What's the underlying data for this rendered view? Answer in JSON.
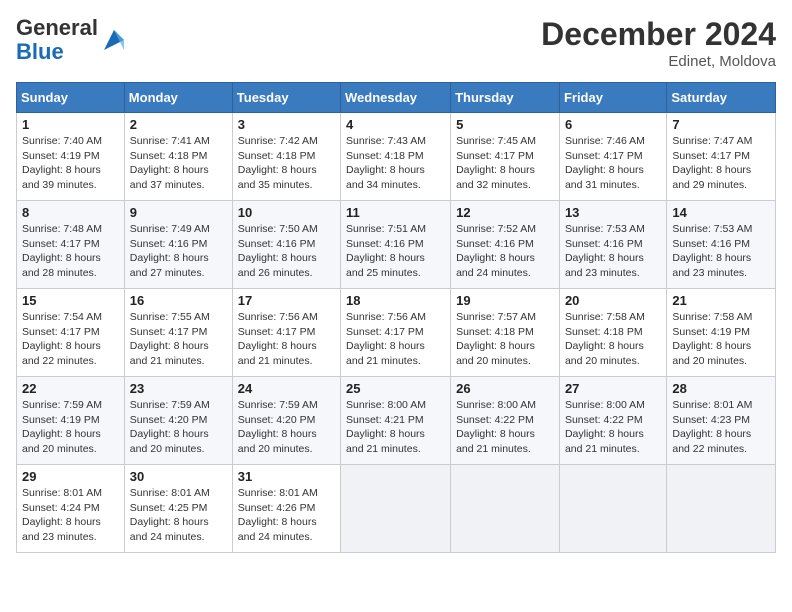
{
  "header": {
    "logo_line1": "General",
    "logo_line2": "Blue",
    "month": "December 2024",
    "location": "Edinet, Moldova"
  },
  "weekdays": [
    "Sunday",
    "Monday",
    "Tuesday",
    "Wednesday",
    "Thursday",
    "Friday",
    "Saturday"
  ],
  "weeks": [
    [
      {
        "day": "1",
        "sunrise": "7:40 AM",
        "sunset": "4:19 PM",
        "daylight": "8 hours and 39 minutes."
      },
      {
        "day": "2",
        "sunrise": "7:41 AM",
        "sunset": "4:18 PM",
        "daylight": "8 hours and 37 minutes."
      },
      {
        "day": "3",
        "sunrise": "7:42 AM",
        "sunset": "4:18 PM",
        "daylight": "8 hours and 35 minutes."
      },
      {
        "day": "4",
        "sunrise": "7:43 AM",
        "sunset": "4:18 PM",
        "daylight": "8 hours and 34 minutes."
      },
      {
        "day": "5",
        "sunrise": "7:45 AM",
        "sunset": "4:17 PM",
        "daylight": "8 hours and 32 minutes."
      },
      {
        "day": "6",
        "sunrise": "7:46 AM",
        "sunset": "4:17 PM",
        "daylight": "8 hours and 31 minutes."
      },
      {
        "day": "7",
        "sunrise": "7:47 AM",
        "sunset": "4:17 PM",
        "daylight": "8 hours and 29 minutes."
      }
    ],
    [
      {
        "day": "8",
        "sunrise": "7:48 AM",
        "sunset": "4:17 PM",
        "daylight": "8 hours and 28 minutes."
      },
      {
        "day": "9",
        "sunrise": "7:49 AM",
        "sunset": "4:16 PM",
        "daylight": "8 hours and 27 minutes."
      },
      {
        "day": "10",
        "sunrise": "7:50 AM",
        "sunset": "4:16 PM",
        "daylight": "8 hours and 26 minutes."
      },
      {
        "day": "11",
        "sunrise": "7:51 AM",
        "sunset": "4:16 PM",
        "daylight": "8 hours and 25 minutes."
      },
      {
        "day": "12",
        "sunrise": "7:52 AM",
        "sunset": "4:16 PM",
        "daylight": "8 hours and 24 minutes."
      },
      {
        "day": "13",
        "sunrise": "7:53 AM",
        "sunset": "4:16 PM",
        "daylight": "8 hours and 23 minutes."
      },
      {
        "day": "14",
        "sunrise": "7:53 AM",
        "sunset": "4:16 PM",
        "daylight": "8 hours and 23 minutes."
      }
    ],
    [
      {
        "day": "15",
        "sunrise": "7:54 AM",
        "sunset": "4:17 PM",
        "daylight": "8 hours and 22 minutes."
      },
      {
        "day": "16",
        "sunrise": "7:55 AM",
        "sunset": "4:17 PM",
        "daylight": "8 hours and 21 minutes."
      },
      {
        "day": "17",
        "sunrise": "7:56 AM",
        "sunset": "4:17 PM",
        "daylight": "8 hours and 21 minutes."
      },
      {
        "day": "18",
        "sunrise": "7:56 AM",
        "sunset": "4:17 PM",
        "daylight": "8 hours and 21 minutes."
      },
      {
        "day": "19",
        "sunrise": "7:57 AM",
        "sunset": "4:18 PM",
        "daylight": "8 hours and 20 minutes."
      },
      {
        "day": "20",
        "sunrise": "7:58 AM",
        "sunset": "4:18 PM",
        "daylight": "8 hours and 20 minutes."
      },
      {
        "day": "21",
        "sunrise": "7:58 AM",
        "sunset": "4:19 PM",
        "daylight": "8 hours and 20 minutes."
      }
    ],
    [
      {
        "day": "22",
        "sunrise": "7:59 AM",
        "sunset": "4:19 PM",
        "daylight": "8 hours and 20 minutes."
      },
      {
        "day": "23",
        "sunrise": "7:59 AM",
        "sunset": "4:20 PM",
        "daylight": "8 hours and 20 minutes."
      },
      {
        "day": "24",
        "sunrise": "7:59 AM",
        "sunset": "4:20 PM",
        "daylight": "8 hours and 20 minutes."
      },
      {
        "day": "25",
        "sunrise": "8:00 AM",
        "sunset": "4:21 PM",
        "daylight": "8 hours and 21 minutes."
      },
      {
        "day": "26",
        "sunrise": "8:00 AM",
        "sunset": "4:22 PM",
        "daylight": "8 hours and 21 minutes."
      },
      {
        "day": "27",
        "sunrise": "8:00 AM",
        "sunset": "4:22 PM",
        "daylight": "8 hours and 21 minutes."
      },
      {
        "day": "28",
        "sunrise": "8:01 AM",
        "sunset": "4:23 PM",
        "daylight": "8 hours and 22 minutes."
      }
    ],
    [
      {
        "day": "29",
        "sunrise": "8:01 AM",
        "sunset": "4:24 PM",
        "daylight": "8 hours and 23 minutes."
      },
      {
        "day": "30",
        "sunrise": "8:01 AM",
        "sunset": "4:25 PM",
        "daylight": "8 hours and 24 minutes."
      },
      {
        "day": "31",
        "sunrise": "8:01 AM",
        "sunset": "4:26 PM",
        "daylight": "8 hours and 24 minutes."
      },
      null,
      null,
      null,
      null
    ]
  ],
  "labels": {
    "sunrise": "Sunrise:",
    "sunset": "Sunset:",
    "daylight": "Daylight:"
  }
}
